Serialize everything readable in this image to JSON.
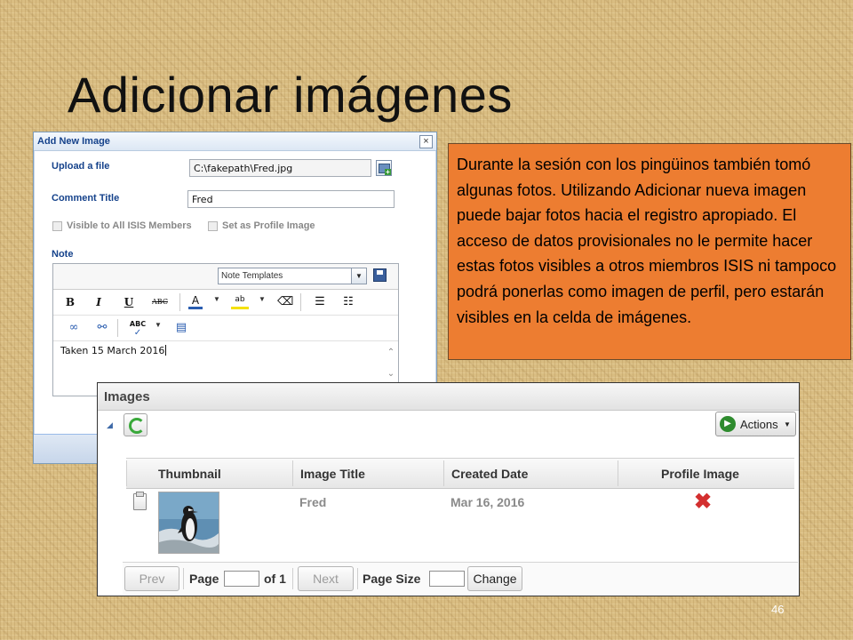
{
  "slide": {
    "title": "Adicionar imágenes",
    "page_number": "46"
  },
  "dialog": {
    "title": "Add New Image",
    "close_label": "×",
    "upload_label": "Upload a file",
    "upload_value": "C:\\fakepath\\Fred.jpg",
    "comment_title_label": "Comment Title",
    "comment_title_value": "Fred",
    "visible_label": "Visible to All ISIS Members",
    "profile_label": "Set as Profile Image",
    "note_label": "Note",
    "note_templates_value": "Note Templates",
    "toolbar": {
      "bold": "B",
      "italic": "I",
      "underline": "U",
      "strike": "ABC",
      "font_color": "A",
      "highlight": "ab",
      "spell": "ABC"
    },
    "note_text": "Taken 15 March 2016"
  },
  "callout": {
    "text": "Durante la sesión con los pingüinos también tomó algunas fotos.  Utilizando Adicionar nueva imagen puede bajar fotos hacia el registro apropiado.  El acceso de datos provisionales no le permite hacer estas fotos visibles a otros miembros ISIS ni tampoco podrá ponerlas como imagen de perfil, pero estarán visibles en la celda de imágenes.",
    "color": "#ed7d31"
  },
  "images_panel": {
    "title": "Images",
    "actions_label": "Actions",
    "columns": [
      "Thumbnail",
      "Image Title",
      "Created Date",
      "Profile Image"
    ],
    "rows": [
      {
        "image_title": "Fred",
        "created_date": "Mar 16, 2016",
        "profile_image": "✖"
      }
    ],
    "pager": {
      "prev": "Prev",
      "page_label": "Page",
      "page_value": "",
      "of_label": "of 1",
      "next": "Next",
      "page_size_label": "Page Size",
      "page_size_value": "",
      "change": "Change"
    }
  }
}
